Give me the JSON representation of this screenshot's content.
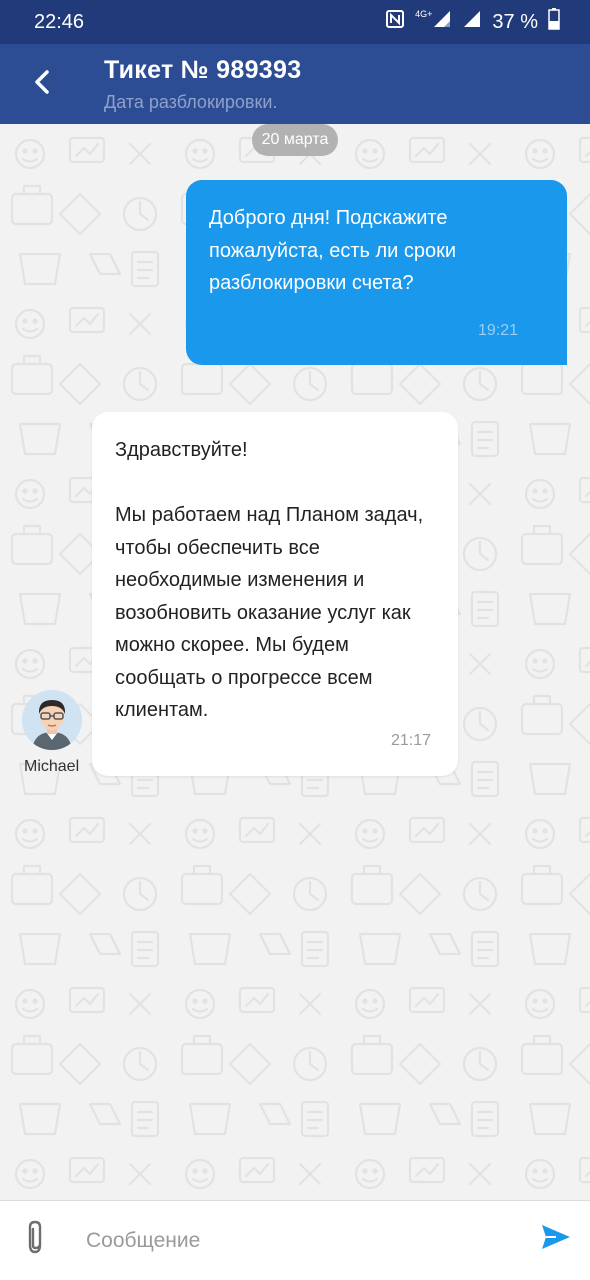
{
  "status_bar": {
    "time": "22:46",
    "network_tag": "4G+",
    "battery_text": "37 %",
    "icons": [
      "nfc-icon",
      "signal-4g-icon",
      "signal-icon",
      "battery-icon"
    ]
  },
  "app_bar": {
    "title": "Тикет № 989393",
    "subtitle": "Дата разблокировки.",
    "back_icon": "chevron-left-icon"
  },
  "chat": {
    "date_label": "20 марта",
    "messages": [
      {
        "direction": "outgoing",
        "text": "Доброго дня! Подскажите пожалуйста, есть ли сроки разблокировки счета?",
        "time": "19:21"
      },
      {
        "direction": "incoming",
        "author": "Michael",
        "text": "Здравствуйте!\n\nМы работаем над Планом задач, чтобы обеспечить все необходимые изменения и возобновить оказание услуг как можно скорее. Мы будем сообщать о прогрессе всем клиентам.",
        "time": "21:17"
      }
    ]
  },
  "composer": {
    "placeholder": "Сообщение",
    "value": "",
    "attach_icon": "paperclip-icon",
    "send_icon": "send-icon"
  },
  "colors": {
    "status_bar": "#213b7a",
    "app_bar": "#2c4c94",
    "outgoing_bubble": "#1a98ec",
    "incoming_bubble": "#ffffff",
    "background": "#f2f2f2",
    "send_accent": "#1a98ec"
  }
}
